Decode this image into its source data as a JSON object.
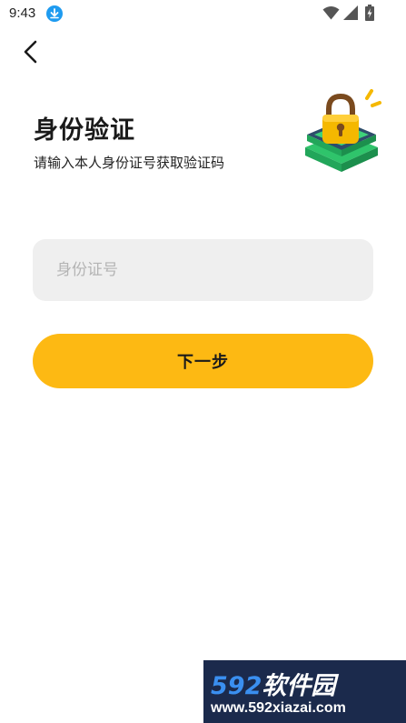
{
  "status_bar": {
    "time": "9:43"
  },
  "header": {
    "back_icon": "chevron-left-icon"
  },
  "title": "身份验证",
  "subtitle": "请输入本人身份证号获取验证码",
  "form": {
    "id_input_placeholder": "身份证号",
    "id_input_value": ""
  },
  "next_button_label": "下一步",
  "colors": {
    "accent": "#fdb913",
    "input_bg": "#efefef",
    "lock_gold": "#f5b800",
    "lock_green": "#2fc46b",
    "lock_dark": "#2e4d6b"
  },
  "watermark": {
    "brand_num": "592",
    "brand_text": "软件园",
    "url": "www.592xiazai.com"
  }
}
